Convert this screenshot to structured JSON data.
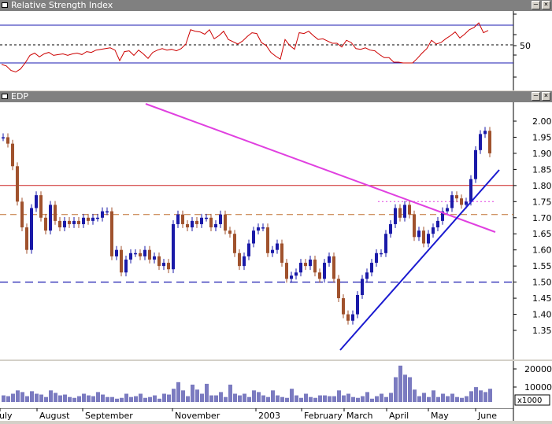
{
  "rsi_panel": {
    "title": "Relative Strength Index",
    "tick_label": "50",
    "levels": {
      "upper": 80,
      "middle": 50,
      "lower": 30
    }
  },
  "price_panel": {
    "title": "EDP",
    "y_ticks": [
      "2.00",
      "1.95",
      "1.90",
      "1.85",
      "1.80",
      "1.75",
      "1.70",
      "1.65",
      "1.60",
      "1.55",
      "1.50",
      "1.45",
      "1.40",
      "1.35"
    ],
    "lines": {
      "resistance_red": 1.8,
      "dashed_orange": 1.71,
      "dashed_blue": 1.5,
      "dotted_pink": 1.75
    }
  },
  "volume_panel": {
    "y_ticks": [
      "20000",
      "10000"
    ],
    "multiplier": "x1000"
  },
  "x_axis": {
    "labels": [
      "uly",
      "August",
      "September",
      "November",
      "2003",
      "February",
      "March",
      "April",
      "May",
      "June"
    ]
  },
  "colors": {
    "rsi_line": "#cc0000",
    "up_bar": "#1a1aa8",
    "down_bar": "#a0522d",
    "trend_magenta": "#e040e0",
    "trend_blue": "#1a1ad0",
    "volume_fill": "#7b7bc0",
    "titlebar": "#808080"
  },
  "chart_data": [
    {
      "type": "line",
      "title": "Relative Strength Index",
      "ylim": [
        0,
        100
      ],
      "reference_lines": [
        80,
        50,
        30
      ],
      "x": [
        0,
        6,
        12,
        18,
        24,
        30,
        36,
        42,
        48,
        54,
        60,
        66,
        72,
        78,
        84,
        90,
        96,
        102,
        108,
        114,
        120,
        126,
        132,
        138,
        144,
        150,
        156,
        162,
        168,
        174,
        180,
        186,
        192,
        198,
        204,
        210,
        216,
        222,
        228,
        234,
        240,
        246,
        252,
        258,
        264,
        270,
        276,
        282,
        288,
        294,
        300,
        306,
        312,
        318,
        324,
        330,
        336,
        342,
        348,
        354,
        360,
        366,
        372,
        378,
        384,
        390,
        396,
        402,
        408,
        414,
        420,
        426,
        432,
        438,
        444,
        450,
        456,
        462,
        468,
        474,
        480,
        486,
        492,
        498,
        504,
        510,
        516,
        522,
        528,
        534,
        540,
        546,
        552,
        558,
        564,
        570,
        576,
        582,
        588,
        594,
        600,
        606,
        612,
        618
      ],
      "values": [
        28,
        26,
        20,
        18,
        22,
        30,
        40,
        43,
        38,
        42,
        44,
        40,
        41,
        42,
        40,
        42,
        43,
        41,
        45,
        44,
        47,
        48,
        49,
        50,
        47,
        33,
        45,
        46,
        40,
        47,
        42,
        36,
        44,
        47,
        49,
        47,
        48,
        46,
        49,
        55,
        74,
        72,
        71,
        68,
        74,
        62,
        66,
        72,
        61,
        58,
        55,
        59,
        65,
        70,
        69,
        57,
        53,
        44,
        39,
        35,
        61,
        53,
        48,
        70,
        69,
        72,
        66,
        61,
        62,
        59,
        56,
        56,
        51,
        60,
        57,
        49,
        48,
        50,
        47,
        46,
        41,
        37,
        37,
        31,
        31,
        30,
        30,
        30,
        36,
        43,
        49,
        60,
        55,
        57,
        62,
        66,
        71,
        63,
        68,
        74,
        77,
        83,
        70,
        73
      ]
    },
    {
      "type": "bar",
      "title": "EDP",
      "note": "candlestick / OHLC daily bars",
      "ylim": [
        1.33,
        2.02
      ],
      "x": [
        0,
        6,
        12,
        18,
        24,
        30,
        36,
        42,
        48,
        54,
        60,
        66,
        72,
        78,
        84,
        90,
        96,
        102,
        108,
        114,
        120,
        126,
        132,
        138,
        144,
        150,
        156,
        162,
        168,
        174,
        180,
        186,
        192,
        198,
        204,
        210,
        216,
        222,
        228,
        234,
        240,
        246,
        252,
        258,
        264,
        270,
        276,
        282,
        288,
        294,
        300,
        306,
        312,
        318,
        324,
        330,
        336,
        342,
        348,
        354,
        360,
        366,
        372,
        378,
        384,
        390,
        396,
        402,
        408,
        414,
        420,
        426,
        432,
        438,
        444,
        450,
        456,
        462,
        468,
        474,
        480,
        486,
        492,
        498,
        504,
        510,
        516,
        522,
        528,
        534,
        540,
        546,
        552,
        558,
        564,
        570,
        576,
        582,
        588,
        594,
        600,
        606,
        612,
        618
      ],
      "values": [
        1.95,
        1.93,
        1.86,
        1.75,
        1.67,
        1.6,
        1.73,
        1.77,
        1.7,
        1.66,
        1.74,
        1.69,
        1.67,
        1.69,
        1.68,
        1.69,
        1.68,
        1.7,
        1.69,
        1.7,
        1.7,
        1.72,
        1.72,
        1.58,
        1.6,
        1.53,
        1.57,
        1.59,
        1.59,
        1.58,
        1.6,
        1.57,
        1.58,
        1.55,
        1.56,
        1.54,
        1.68,
        1.71,
        1.68,
        1.67,
        1.69,
        1.68,
        1.7,
        1.7,
        1.67,
        1.68,
        1.71,
        1.66,
        1.65,
        1.59,
        1.55,
        1.58,
        1.62,
        1.66,
        1.67,
        1.67,
        1.59,
        1.6,
        1.62,
        1.56,
        1.51,
        1.52,
        1.53,
        1.56,
        1.55,
        1.57,
        1.53,
        1.51,
        1.56,
        1.58,
        1.51,
        1.45,
        1.4,
        1.38,
        1.4,
        1.46,
        1.51,
        1.53,
        1.56,
        1.59,
        1.59,
        1.65,
        1.68,
        1.73,
        1.7,
        1.74,
        1.71,
        1.64,
        1.66,
        1.62,
        1.65,
        1.67,
        1.69,
        1.72,
        1.73,
        1.77,
        1.76,
        1.74,
        1.75,
        1.82,
        1.91,
        1.96,
        1.97,
        1.9
      ]
    },
    {
      "type": "bar",
      "title": "Volume",
      "ylim": [
        0,
        25000
      ],
      "x": [
        0,
        6,
        12,
        18,
        24,
        30,
        36,
        42,
        48,
        54,
        60,
        66,
        72,
        78,
        84,
        90,
        96,
        102,
        108,
        114,
        120,
        126,
        132,
        138,
        144,
        150,
        156,
        162,
        168,
        174,
        180,
        186,
        192,
        198,
        204,
        210,
        216,
        222,
        228,
        234,
        240,
        246,
        252,
        258,
        264,
        270,
        276,
        282,
        288,
        294,
        300,
        306,
        312,
        318,
        324,
        330,
        336,
        342,
        348,
        354,
        360,
        366,
        372,
        378,
        384,
        390,
        396,
        402,
        408,
        414,
        420,
        426,
        432,
        438,
        444,
        450,
        456,
        462,
        468,
        474,
        480,
        486,
        492,
        498,
        504,
        510,
        516,
        522,
        528,
        534,
        540,
        546,
        552,
        558,
        564,
        570,
        576,
        582,
        588,
        594,
        600,
        606,
        612,
        618
      ],
      "values": [
        4000,
        3500,
        5000,
        7000,
        6000,
        3500,
        6500,
        5000,
        4500,
        3000,
        7000,
        5500,
        4000,
        4500,
        3000,
        2500,
        3500,
        5000,
        4000,
        3500,
        6000,
        4500,
        3000,
        3000,
        2000,
        2500,
        5000,
        3000,
        3500,
        5000,
        2500,
        3000,
        4000,
        2000,
        5000,
        4500,
        8000,
        12000,
        7000,
        3500,
        10500,
        7500,
        5000,
        11000,
        4000,
        4000,
        6000,
        3000,
        10500,
        5000,
        4000,
        5000,
        3000,
        7000,
        6000,
        4000,
        3000,
        7000,
        4000,
        3000,
        2500,
        8000,
        4000,
        2500,
        5000,
        3000,
        2500,
        4000,
        4000,
        3500,
        3500,
        7000,
        4000,
        5000,
        3000,
        2500,
        3500,
        6000,
        2000,
        3500,
        5000,
        3000,
        5500,
        15000,
        22000,
        16500,
        15000,
        7500,
        3500,
        5500,
        3000,
        7000,
        3000,
        5000,
        3500,
        5000,
        3000,
        2500,
        3500,
        6500,
        9000,
        7000,
        6000,
        8000
      ]
    }
  ]
}
